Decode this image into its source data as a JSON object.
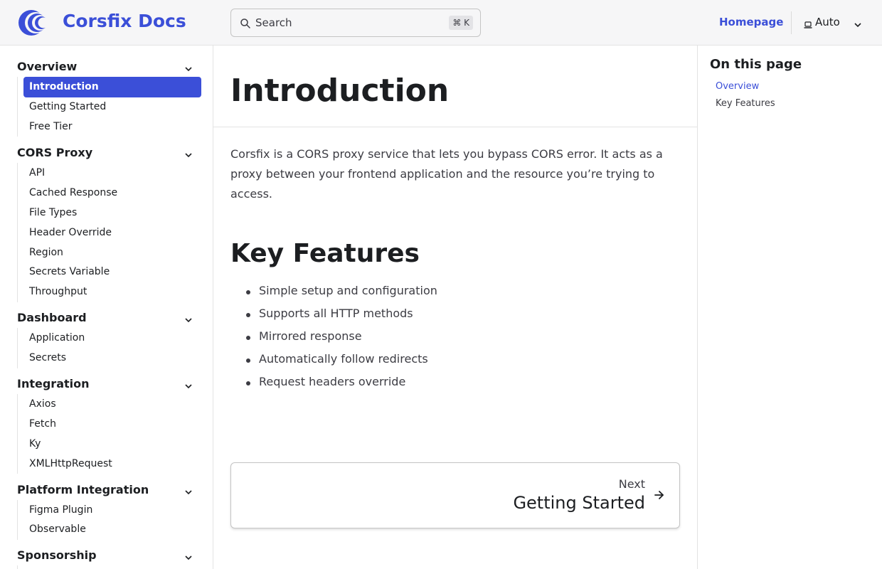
{
  "header": {
    "brand": "Corsfix Docs",
    "search_placeholder": "Search",
    "search_shortcut": "⌘ K",
    "homepage_label": "Homepage",
    "theme_label": "Auto"
  },
  "sidebar": {
    "active_item": "Introduction",
    "groups": [
      {
        "title": "Overview",
        "items": [
          "Introduction",
          "Getting Started",
          "Free Tier"
        ]
      },
      {
        "title": "CORS Proxy",
        "items": [
          "API",
          "Cached Response",
          "File Types",
          "Header Override",
          "Region",
          "Secrets Variable",
          "Throughput"
        ]
      },
      {
        "title": "Dashboard",
        "items": [
          "Application",
          "Secrets"
        ]
      },
      {
        "title": "Integration",
        "items": [
          "Axios",
          "Fetch",
          "Ky",
          "XMLHttpRequest"
        ]
      },
      {
        "title": "Platform Integration",
        "items": [
          "Figma Plugin",
          "Observable"
        ]
      },
      {
        "title": "Sponsorship",
        "items": []
      }
    ]
  },
  "main": {
    "title": "Introduction",
    "intro": "Corsfix is a CORS proxy service that lets you bypass CORS error. It acts as a proxy between your frontend application and the resource you’re trying to access.",
    "features_heading": "Key Features",
    "features": [
      "Simple setup and configuration",
      "Supports all HTTP methods",
      "Mirrored response",
      "Automatically follow redirects",
      "Request headers override"
    ],
    "next_label": "Next",
    "next_title": "Getting Started"
  },
  "toc": {
    "title": "On this page",
    "links": [
      "Overview",
      "Key Features"
    ]
  },
  "colors": {
    "accent": "#3b4fd8",
    "header_bg": "#f6f6f7",
    "text": "#1c1e21",
    "muted_text": "#3c3c43"
  },
  "icons": {
    "logo": "corsfix-logo-icon",
    "search": "search-icon",
    "theme": "laptop-icon",
    "theme_caret": "chevron-down-icon",
    "group_caret": "chevron-down-icon",
    "next": "arrow-right-icon"
  }
}
